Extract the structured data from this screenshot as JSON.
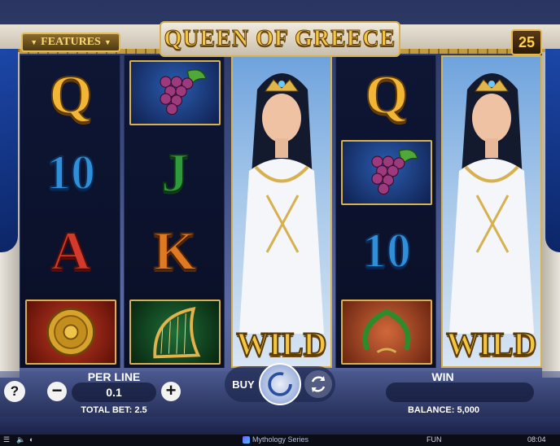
{
  "header": {
    "features_label": "FEATURES",
    "title": "QUEEN OF GREECE",
    "lines_count": "25"
  },
  "reels": {
    "reel1": [
      "Q",
      "10",
      "A",
      "shield-icon"
    ],
    "reel2": [
      "grapes-icon",
      "J",
      "K",
      "harp-icon"
    ],
    "reel3": [
      "queen-wild"
    ],
    "reel4": [
      "Q",
      "grapes-icon",
      "10",
      "laurel-wreath-icon"
    ],
    "reel5": [
      "queen-wild"
    ],
    "wild_label": "WILD"
  },
  "controls": {
    "help_label": "?",
    "perline_label": "PER LINE",
    "perline_value": "0.1",
    "minus_label": "−",
    "plus_label": "+",
    "total_bet": "TOTAL BET: 2.5",
    "buy_label": "BUY",
    "win_label": "WIN",
    "win_value": "",
    "balance": "BALANCE: 5,000"
  },
  "status_bar": {
    "menu_icon": "menu-icon",
    "sound_icon": "sound-icon",
    "speed_icon": "speed-icon",
    "series": "Mythology Series",
    "mode": "FUN",
    "time": "08:04"
  },
  "colors": {
    "gold": "#f2b637",
    "blue_letter": "#2f8fd8",
    "red_letter": "#d23a2c",
    "green_letter": "#2e9a3c",
    "orange_letter": "#e07a22",
    "background": "#2a3560"
  }
}
